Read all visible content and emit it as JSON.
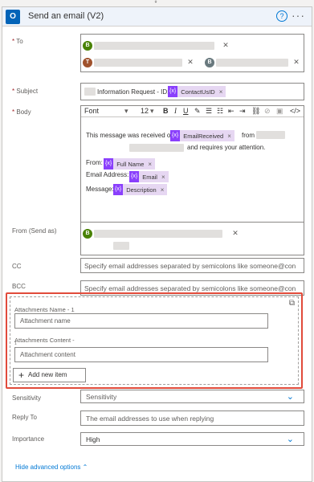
{
  "action": {
    "title": "Send an email (V2)",
    "app_icon_letter": "O",
    "help_glyph": "?",
    "more_glyph": "···",
    "flow_arrow_glyph": "↓"
  },
  "to": {
    "label": "To",
    "recipients": [
      {
        "initial": "B",
        "color": "#498205"
      },
      {
        "initial": "T",
        "color": "#a0522d"
      },
      {
        "initial": "B",
        "color": "#69797e"
      }
    ]
  },
  "subject": {
    "label": "Subject",
    "prefix": "Information Request - ID:",
    "token": "ContactUsID"
  },
  "body": {
    "label": "Body",
    "font_name": "Font",
    "font_size": "12",
    "line1_prefix": "This message was received on",
    "line1_token": "EmailReceived",
    "line1_suffix": "from",
    "line2_suffix": "and requires your attention.",
    "from_label": "From:",
    "from_token": "Full Name",
    "email_label": "Email Address:",
    "email_token": "Email",
    "message_label": "Message:",
    "message_token": "Description"
  },
  "from_send_as": {
    "label": "From (Send as)",
    "initial": "B",
    "color": "#498205"
  },
  "cc": {
    "label": "CC",
    "placeholder": "Specify email addresses separated by semicolons like someone@con"
  },
  "bcc": {
    "label": "BCC",
    "placeholder": "Specify email addresses separated by semicolons like someone@con"
  },
  "attachments": {
    "name_label": "Attachments Name - 1",
    "name_placeholder": "Attachment name",
    "content_label": "Attachments Content -",
    "content_label_2": "1",
    "content_placeholder": "Attachment content",
    "add_button": "Add new item"
  },
  "sensitivity": {
    "label": "Sensitivity",
    "value": "Sensitivity"
  },
  "reply_to": {
    "label": "Reply To",
    "placeholder": "The email addresses to use when replying"
  },
  "importance": {
    "label": "Importance",
    "value": "High"
  },
  "hide_advanced": "Hide advanced options",
  "token_fx": "{x}",
  "token_close": "×"
}
